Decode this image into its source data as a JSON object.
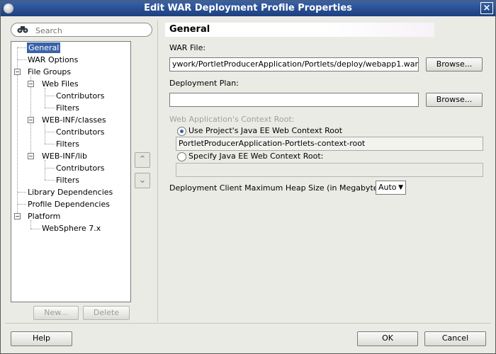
{
  "window": {
    "title": "Edit WAR Deployment Profile Properties",
    "close": "×"
  },
  "search": {
    "placeholder": "Search",
    "icon": "binoculars-icon"
  },
  "tree": {
    "items": [
      {
        "label": "General",
        "selected": true
      },
      {
        "label": "WAR Options"
      },
      {
        "label": "File Groups"
      },
      {
        "label": "Web Files"
      },
      {
        "label": "Contributors"
      },
      {
        "label": "Filters"
      },
      {
        "label": "WEB-INF/classes"
      },
      {
        "label": "Contributors"
      },
      {
        "label": "Filters"
      },
      {
        "label": "WEB-INF/lib"
      },
      {
        "label": "Contributors"
      },
      {
        "label": "Filters"
      },
      {
        "label": "Library Dependencies"
      },
      {
        "label": "Profile Dependencies"
      },
      {
        "label": "Platform"
      },
      {
        "label": "WebSphere 7.x"
      }
    ],
    "new_label": "New...",
    "delete_label": "Delete",
    "up_arrow": "⌃",
    "down_arrow": "⌄"
  },
  "panel": {
    "heading": "General",
    "war_file_label": "WAR File:",
    "war_file_value": "ywork/PortletProducerApplication/Portlets/deploy/webapp1.war",
    "browse_label": "Browse...",
    "plan_label": "Deployment Plan:",
    "plan_value": "",
    "browse2_label": "Browse...",
    "context_root_label": "Web Application's Context Root:",
    "radio_project_label": "Use Project's Java EE Web Context Root",
    "project_root_value": "PortletProducerApplication-Portlets-context-root",
    "radio_specify_label": "Specify Java EE Web Context Root:",
    "specify_value": "",
    "heap_label": "Deployment Client Maximum Heap Size (in Megabytes):",
    "heap_value": "Auto",
    "heap_caret": "▼"
  },
  "footer": {
    "help_label": "Help",
    "ok_label": "OK",
    "cancel_label": "Cancel"
  }
}
